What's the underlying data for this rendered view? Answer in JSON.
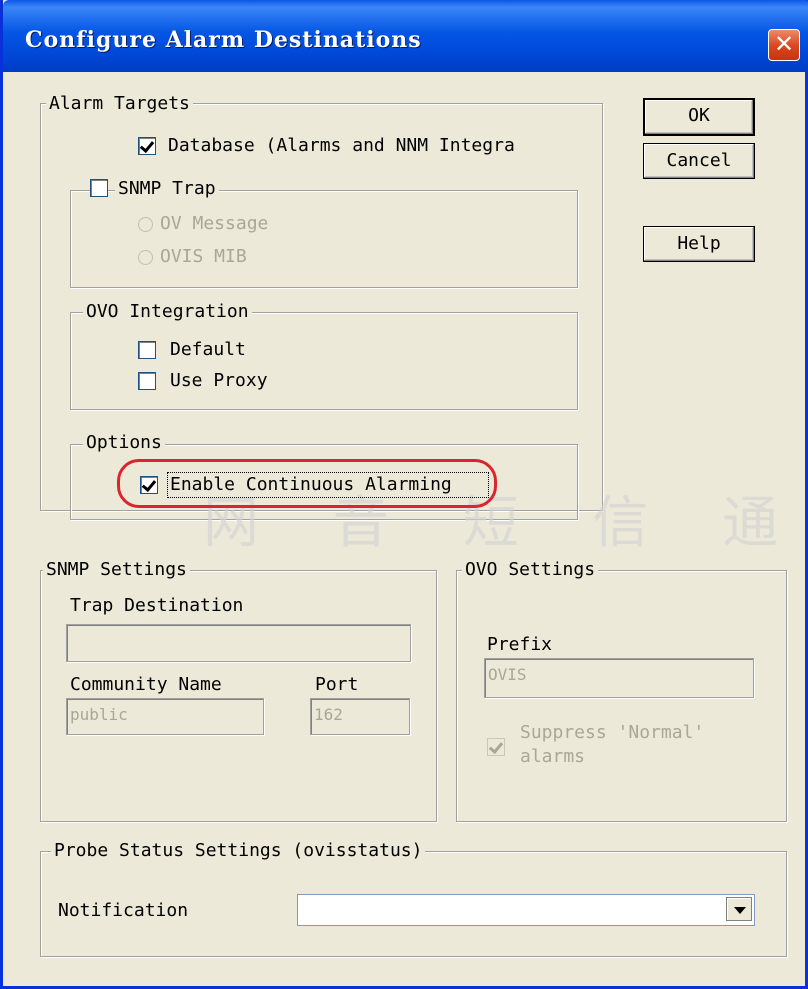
{
  "window": {
    "title": "Configure Alarm Destinations",
    "close_glyph": "✕"
  },
  "buttons": {
    "ok": "OK",
    "cancel": "Cancel",
    "help": "Help"
  },
  "alarm_targets": {
    "legend": "Alarm Targets",
    "database": {
      "label": "Database (Alarms and NNM Integra",
      "checked": true
    },
    "snmp_trap": {
      "label": "SNMP Trap",
      "checked": false,
      "ov_message": "OV Message",
      "ovis_mib": "OVIS MIB"
    },
    "ovo_integration": {
      "legend": "OVO Integration",
      "default": {
        "label": "Default",
        "checked": false
      },
      "use_proxy": {
        "label": "Use Proxy",
        "checked": false
      }
    },
    "options": {
      "legend": "Options",
      "enable_continuous": {
        "label": "Enable Continuous Alarming",
        "checked": true
      }
    }
  },
  "snmp_settings": {
    "legend": "SNMP Settings",
    "trap_destination_label": "Trap Destination",
    "trap_destination_value": "",
    "community_name_label": "Community Name",
    "community_name_value": "public",
    "port_label": "Port",
    "port_value": "162"
  },
  "ovo_settings": {
    "legend": "OVO Settings",
    "prefix_label": "Prefix",
    "prefix_value": "OVIS",
    "suppress_label_line1": "Suppress 'Normal'",
    "suppress_label_line2": "alarms",
    "suppress_checked": true
  },
  "probe_status": {
    "legend": "Probe Status Settings (ovisstatus)",
    "notification_label": "Notification",
    "notification_value": ""
  },
  "watermark": "网 音 短 信 通"
}
